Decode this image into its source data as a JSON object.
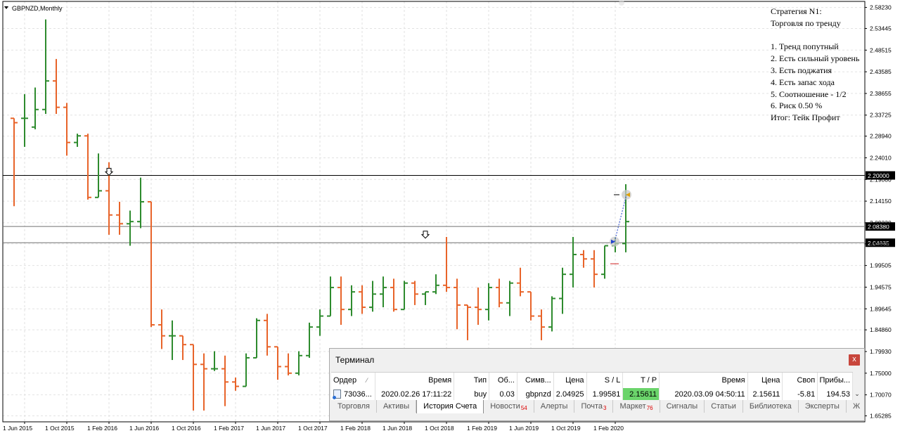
{
  "window": {
    "chart_title": "GBPNZD,Monthly",
    "menu_icon": "triangle-down-icon"
  },
  "colors": {
    "bull": "#2e8b2e",
    "bear": "#e8642a",
    "grid": "#e2e2e2",
    "tp_highlight": "#6bd46b"
  },
  "strategy": {
    "lines": [
      "Стратегия N1:",
      "Торговля по тренду",
      "",
      "1. Тренд попутный",
      "2. Есть сильный уровень",
      "3. Есть поджатия",
      "4. Есть запас хода",
      "5. Соотношение - 1/2",
      "6. Риск 0.50 %",
      "Итог: Тейк Профит"
    ]
  },
  "chart_data": {
    "type": "ohlc",
    "symbol": "GBPNZD",
    "timeframe": "Monthly",
    "ylim": [
      1.6425,
      2.5848
    ],
    "y_ticks": [
      "2.58230",
      "2.53445",
      "2.48515",
      "2.43585",
      "2.38655",
      "2.33725",
      "2.28940",
      "2.24010",
      "2.19080",
      "2.14150",
      "2.09220",
      "2.04435",
      "1.99505",
      "1.94575",
      "1.89645",
      "1.84860",
      "1.79930",
      "1.75000",
      "1.70070",
      "1.65285"
    ],
    "x_ticks": [
      "1 Jun 2015",
      "1 Oct 2015",
      "1 Feb 2016",
      "1 Jun 2016",
      "1 Oct 2016",
      "1 Feb 2017",
      "1 Jun 2017",
      "1 Oct 2017",
      "1 Feb 2018",
      "1 Jun 2018",
      "1 Oct 2018",
      "1 Feb 2019",
      "1 Jun 2019",
      "1 Oct 2019",
      "1 Feb 2020"
    ],
    "hlines": [
      {
        "price": 2.2,
        "label": "2.20000",
        "color": "#000000"
      },
      {
        "price": 2.0838,
        "label": "2.08380",
        "color": "#707070"
      },
      {
        "price": 2.04685,
        "label": "2.04685",
        "color": "#707070"
      }
    ],
    "markers": [
      {
        "month": "2016-02",
        "price": 2.205,
        "type": "arrow-down"
      },
      {
        "month": "2018-08",
        "price": 2.062,
        "type": "arrow-down"
      }
    ],
    "bars": [
      {
        "m": "2015-05",
        "o": 2.33,
        "h": 2.33,
        "l": 2.13,
        "c": 2.32
      },
      {
        "m": "2015-06",
        "o": 2.33,
        "h": 2.385,
        "l": 2.265,
        "c": 2.33
      },
      {
        "m": "2015-07",
        "o": 2.31,
        "h": 2.4,
        "l": 2.305,
        "c": 2.35
      },
      {
        "m": "2015-08",
        "o": 2.35,
        "h": 2.555,
        "l": 2.34,
        "c": 2.415
      },
      {
        "m": "2015-09",
        "o": 2.415,
        "h": 2.465,
        "l": 2.34,
        "c": 2.355
      },
      {
        "m": "2015-10",
        "o": 2.355,
        "h": 2.365,
        "l": 2.245,
        "c": 2.275
      },
      {
        "m": "2015-11",
        "o": 2.275,
        "h": 2.295,
        "l": 2.265,
        "c": 2.29
      },
      {
        "m": "2015-12",
        "o": 2.29,
        "h": 2.295,
        "l": 2.145,
        "c": 2.15
      },
      {
        "m": "2016-01",
        "o": 2.15,
        "h": 2.25,
        "l": 2.15,
        "c": 2.165
      },
      {
        "m": "2016-02",
        "o": 2.165,
        "h": 2.23,
        "l": 2.065,
        "c": 2.11
      },
      {
        "m": "2016-03",
        "o": 2.11,
        "h": 2.14,
        "l": 2.065,
        "c": 2.09
      },
      {
        "m": "2016-04",
        "o": 2.09,
        "h": 2.12,
        "l": 2.04,
        "c": 2.095
      },
      {
        "m": "2016-05",
        "o": 2.095,
        "h": 2.195,
        "l": 2.08,
        "c": 2.14
      },
      {
        "m": "2016-06",
        "o": 2.14,
        "h": 2.14,
        "l": 1.855,
        "c": 1.86
      },
      {
        "m": "2016-07",
        "o": 1.86,
        "h": 1.895,
        "l": 1.805,
        "c": 1.835
      },
      {
        "m": "2016-08",
        "o": 1.835,
        "h": 1.87,
        "l": 1.78,
        "c": 1.835
      },
      {
        "m": "2016-09",
        "o": 1.835,
        "h": 1.835,
        "l": 1.78,
        "c": 1.815
      },
      {
        "m": "2016-10",
        "o": 1.815,
        "h": 1.815,
        "l": 1.665,
        "c": 1.77
      },
      {
        "m": "2016-11",
        "o": 1.77,
        "h": 1.795,
        "l": 1.665,
        "c": 1.76
      },
      {
        "m": "2016-12",
        "o": 1.76,
        "h": 1.8,
        "l": 1.755,
        "c": 1.76
      },
      {
        "m": "2017-01",
        "o": 1.76,
        "h": 1.79,
        "l": 1.675,
        "c": 1.73
      },
      {
        "m": "2017-02",
        "o": 1.73,
        "h": 1.74,
        "l": 1.71,
        "c": 1.72
      },
      {
        "m": "2017-03",
        "o": 1.72,
        "h": 1.795,
        "l": 1.72,
        "c": 1.785
      },
      {
        "m": "2017-04",
        "o": 1.785,
        "h": 1.875,
        "l": 1.785,
        "c": 1.87
      },
      {
        "m": "2017-05",
        "o": 1.87,
        "h": 1.885,
        "l": 1.79,
        "c": 1.81
      },
      {
        "m": "2017-06",
        "o": 1.81,
        "h": 1.81,
        "l": 1.735,
        "c": 1.765
      },
      {
        "m": "2017-07",
        "o": 1.765,
        "h": 1.795,
        "l": 1.745,
        "c": 1.75
      },
      {
        "m": "2017-08",
        "o": 1.75,
        "h": 1.8,
        "l": 1.745,
        "c": 1.79
      },
      {
        "m": "2017-09",
        "o": 1.79,
        "h": 1.865,
        "l": 1.785,
        "c": 1.855
      },
      {
        "m": "2017-10",
        "o": 1.855,
        "h": 1.895,
        "l": 1.835,
        "c": 1.88
      },
      {
        "m": "2017-11",
        "o": 1.88,
        "h": 1.97,
        "l": 1.88,
        "c": 1.945
      },
      {
        "m": "2017-12",
        "o": 1.945,
        "h": 1.97,
        "l": 1.86,
        "c": 1.895
      },
      {
        "m": "2018-01",
        "o": 1.895,
        "h": 1.95,
        "l": 1.88,
        "c": 1.935
      },
      {
        "m": "2018-02",
        "o": 1.935,
        "h": 1.95,
        "l": 1.885,
        "c": 1.9
      },
      {
        "m": "2018-03",
        "o": 1.9,
        "h": 1.96,
        "l": 1.89,
        "c": 1.93
      },
      {
        "m": "2018-04",
        "o": 1.93,
        "h": 1.97,
        "l": 1.9,
        "c": 1.945
      },
      {
        "m": "2018-05",
        "o": 1.945,
        "h": 1.965,
        "l": 1.89,
        "c": 1.895
      },
      {
        "m": "2018-06",
        "o": 1.895,
        "h": 1.96,
        "l": 1.895,
        "c": 1.955
      },
      {
        "m": "2018-07",
        "o": 1.955,
        "h": 1.96,
        "l": 1.905,
        "c": 1.93
      },
      {
        "m": "2018-08",
        "o": 1.93,
        "h": 1.935,
        "l": 1.905,
        "c": 1.935
      },
      {
        "m": "2018-09",
        "o": 1.935,
        "h": 1.975,
        "l": 1.93,
        "c": 1.95
      },
      {
        "m": "2018-10",
        "o": 1.95,
        "h": 2.06,
        "l": 1.935,
        "c": 1.945
      },
      {
        "m": "2018-11",
        "o": 1.945,
        "h": 1.965,
        "l": 1.85,
        "c": 1.905
      },
      {
        "m": "2018-12",
        "o": 1.905,
        "h": 1.905,
        "l": 1.825,
        "c": 1.9
      },
      {
        "m": "2019-01",
        "o": 1.9,
        "h": 1.945,
        "l": 1.86,
        "c": 1.895
      },
      {
        "m": "2019-02",
        "o": 1.895,
        "h": 1.955,
        "l": 1.87,
        "c": 1.945
      },
      {
        "m": "2019-03",
        "o": 1.945,
        "h": 1.965,
        "l": 1.9,
        "c": 1.91
      },
      {
        "m": "2019-04",
        "o": 1.91,
        "h": 1.96,
        "l": 1.88,
        "c": 1.955
      },
      {
        "m": "2019-05",
        "o": 1.955,
        "h": 1.99,
        "l": 1.925,
        "c": 1.935
      },
      {
        "m": "2019-06",
        "o": 1.935,
        "h": 1.935,
        "l": 1.87,
        "c": 1.88
      },
      {
        "m": "2019-07",
        "o": 1.88,
        "h": 1.895,
        "l": 1.825,
        "c": 1.855
      },
      {
        "m": "2019-08",
        "o": 1.855,
        "h": 1.925,
        "l": 1.845,
        "c": 1.92
      },
      {
        "m": "2019-09",
        "o": 1.92,
        "h": 1.99,
        "l": 1.885,
        "c": 1.975
      },
      {
        "m": "2019-10",
        "o": 1.975,
        "h": 2.06,
        "l": 1.945,
        "c": 2.02
      },
      {
        "m": "2019-11",
        "o": 2.02,
        "h": 2.03,
        "l": 1.99,
        "c": 2.01
      },
      {
        "m": "2019-12",
        "o": 2.01,
        "h": 2.03,
        "l": 1.945,
        "c": 1.975
      },
      {
        "m": "2020-01",
        "o": 1.975,
        "h": 2.04,
        "l": 1.965,
        "c": 2.04
      },
      {
        "m": "2020-02",
        "o": 2.04,
        "h": 2.06,
        "l": 2.025,
        "c": 2.045
      },
      {
        "m": "2020-03",
        "o": 2.045,
        "h": 2.18,
        "l": 2.025,
        "c": 2.095
      }
    ],
    "trade": {
      "open_month": "2020-02",
      "open_price": 2.04925,
      "close_month": "2020-03",
      "close_price": 2.15611,
      "sl_price": 1.99581,
      "tp_price": 2.15611
    }
  },
  "terminal": {
    "title": "Терминал",
    "close_label": "x",
    "columns": [
      "Ордер",
      "Время",
      "Тип",
      "Об...",
      "Симв...",
      "Цена",
      "S / L",
      "T / P",
      "Время",
      "Цена",
      "Своп",
      "Прибы..."
    ],
    "sort_indicator": "⁄",
    "row": [
      "73036...",
      "2020.02.26 17:11:22",
      "buy",
      "0.03",
      "gbpnzd",
      "2.04925",
      "1.99581",
      "2.15611",
      "2020.03.09 04:50:11",
      "2.15611",
      "-5.81",
      "194.53"
    ],
    "scroll_glyph": "⌄",
    "tabs": [
      {
        "label": "Торговля",
        "badge": ""
      },
      {
        "label": "Активы",
        "badge": ""
      },
      {
        "label": "История Счета",
        "badge": "",
        "active": true
      },
      {
        "label": "Новости",
        "badge": "54"
      },
      {
        "label": "Алерты",
        "badge": ""
      },
      {
        "label": "Почта",
        "badge": "3"
      },
      {
        "label": "Маркет",
        "badge": "76"
      },
      {
        "label": "Сигналы",
        "badge": ""
      },
      {
        "label": "Статьи",
        "badge": ""
      },
      {
        "label": "Библиотека",
        "badge": ""
      },
      {
        "label": "Эксперты",
        "badge": ""
      },
      {
        "label": "Ж",
        "badge": ""
      }
    ]
  }
}
